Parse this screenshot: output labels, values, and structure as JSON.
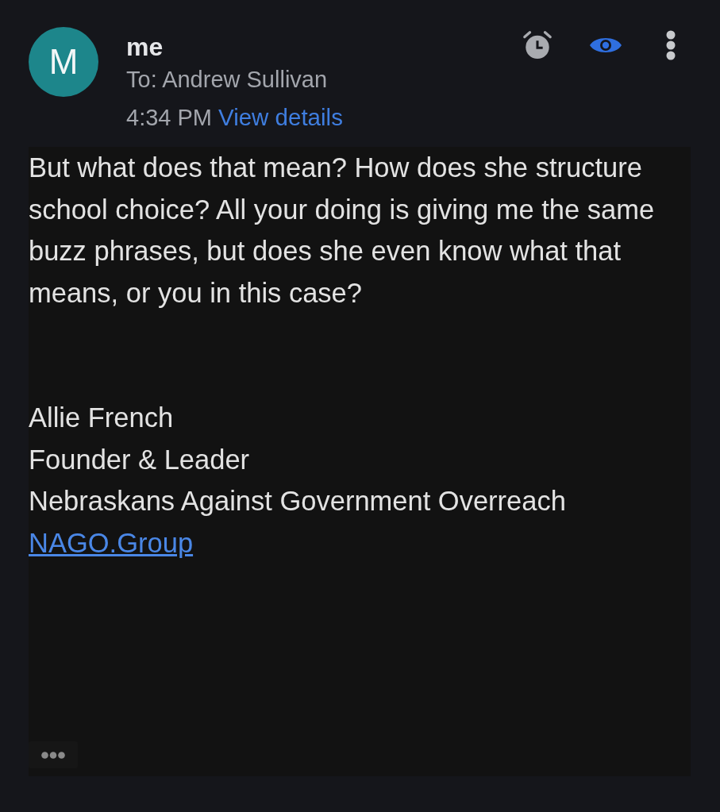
{
  "header": {
    "avatar_letter": "M",
    "sender": "me",
    "recipient": "To: Andrew Sullivan",
    "time": "4:34 PM",
    "details_link": "View details"
  },
  "body": {
    "paragraph": "But what does that mean? How does she structure school choice? All your doing is giving me the same buzz phrases, but does she even know what that means, or you in this case?",
    "signature": [
      {
        "kind": "text",
        "text": "Allie French"
      },
      {
        "kind": "text",
        "text": "Founder & Leader"
      },
      {
        "kind": "text",
        "text": "Nebraskans Against Government Overreach"
      },
      {
        "kind": "link",
        "text": "NAGO.Group"
      }
    ]
  }
}
